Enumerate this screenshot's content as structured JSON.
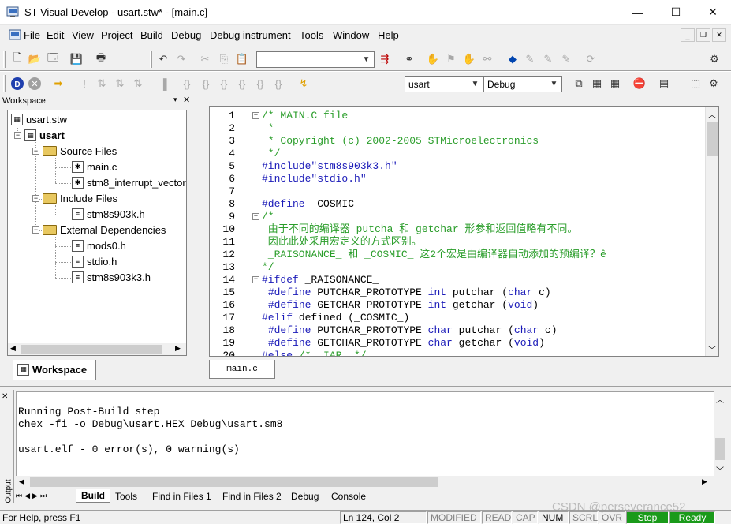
{
  "window": {
    "title": "ST Visual Develop - usart.stw* - [main.c]",
    "minimize_glyph": "—",
    "maximize_glyph": "☐",
    "close_glyph": "✕"
  },
  "menu": [
    "File",
    "Edit",
    "View",
    "Project",
    "Build",
    "Debug",
    "Debug instrument",
    "Tools",
    "Window",
    "Help"
  ],
  "toolbar": {
    "search_value": "",
    "project_combo": "usart",
    "config_combo": "Debug"
  },
  "workspace": {
    "header": "Workspace",
    "root": "usart.stw",
    "project": "usart",
    "folders": [
      {
        "name": "Source Files",
        "files": [
          "main.c",
          "stm8_interrupt_vector"
        ]
      },
      {
        "name": "Include Files",
        "files": [
          "stm8s903k.h"
        ]
      },
      {
        "name": "External Dependencies",
        "files": [
          "mods0.h",
          "stdio.h",
          "stm8s903k3.h"
        ]
      }
    ],
    "tab_label": "Workspace"
  },
  "editor": {
    "tab_label": "main.c",
    "lines": [
      {
        "n": "1",
        "text": "/* MAIN.C file",
        "cls": "cm",
        "fold": "−"
      },
      {
        "n": "2",
        "text": " *",
        "cls": "cm"
      },
      {
        "n": "3",
        "text": " * Copyright (c) 2002-2005 STMicroelectronics",
        "cls": "cm"
      },
      {
        "n": "4",
        "text": " */",
        "cls": "cm"
      },
      {
        "n": "5",
        "text": "#include\"stm8s903k3.h\"",
        "cls": "pp"
      },
      {
        "n": "6",
        "text": "#include\"stdio.h\"",
        "cls": "pp"
      },
      {
        "n": "7",
        "text": "",
        "cls": ""
      },
      {
        "n": "8",
        "text": "#define _COSMIC_",
        "cls": "mix_define"
      },
      {
        "n": "9",
        "text": "/*",
        "cls": "cm",
        "fold": "−"
      },
      {
        "n": "10",
        "text": " 由于不同的编译器 putcha 和 getchar 形参和返回值略有不同。",
        "cls": "cm"
      },
      {
        "n": "11",
        "text": " 因此此处采用宏定义的方式区别。",
        "cls": "cm"
      },
      {
        "n": "12",
        "text": " _RAISONANCE_ 和 _COSMIC_ 这2个宏是由编译器自动添加的预编译？ê",
        "cls": "cm"
      },
      {
        "n": "13",
        "text": "*/",
        "cls": "cm"
      },
      {
        "n": "14",
        "text": "#ifdef _RAISONANCE_",
        "cls": "mix_ifdef",
        "fold": "−"
      },
      {
        "n": "15",
        "text": " #define PUTCHAR_PROTOTYPE int putchar (char c)",
        "cls": "mix"
      },
      {
        "n": "16",
        "text": " #define GETCHAR_PROTOTYPE int getchar (void)",
        "cls": "mix"
      },
      {
        "n": "17",
        "text": "#elif defined (_COSMIC_)",
        "cls": "mix_elif"
      },
      {
        "n": "18",
        "text": " #define PUTCHAR_PROTOTYPE char putchar (char c)",
        "cls": "mix"
      },
      {
        "n": "19",
        "text": " #define GETCHAR_PROTOTYPE char getchar (void)",
        "cls": "mix"
      },
      {
        "n": "20",
        "text": "#else /* _IAR_ */",
        "cls": "mix_else"
      }
    ]
  },
  "output": {
    "label": "Output",
    "lines": [
      "",
      "Running Post-Build step",
      "chex -fi -o Debug\\usart.HEX Debug\\usart.sm8",
      "",
      "usart.elf - 0 error(s), 0 warning(s)"
    ],
    "tabs": [
      "Build",
      "Tools",
      "Find in Files 1",
      "Find in Files 2",
      "Debug",
      "Console"
    ],
    "active_tab": "Build"
  },
  "status": {
    "help": "For Help, press F1",
    "position": "Ln 124, Col 2",
    "indicators": [
      "MODIFIED",
      "READ",
      "CAP",
      "NUM",
      "SCRL",
      "OVR"
    ],
    "stop": "Stop",
    "ready": "Ready"
  },
  "watermark": "CSDN @perseverance52"
}
